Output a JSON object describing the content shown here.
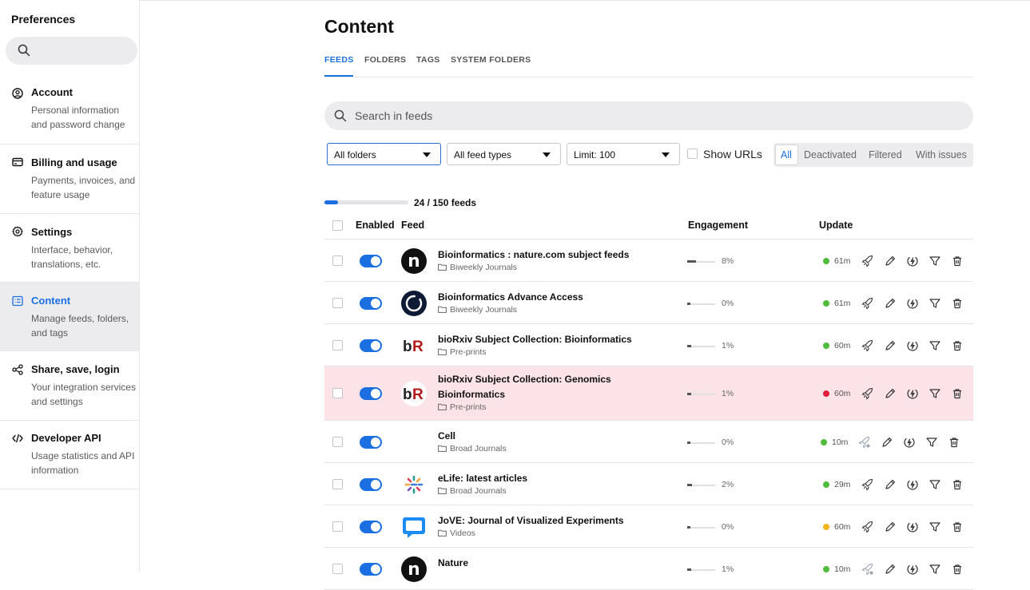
{
  "sidebar": {
    "title": "Preferences",
    "items": [
      {
        "key": "account",
        "label": "Account",
        "desc": "Personal information and password change",
        "icon": "user-circle-icon"
      },
      {
        "key": "billing",
        "label": "Billing and usage",
        "desc": "Payments, invoices, and feature usage",
        "icon": "card-icon"
      },
      {
        "key": "settings",
        "label": "Settings",
        "desc": "Interface, behavior, translations, etc.",
        "icon": "gear-icon"
      },
      {
        "key": "content",
        "label": "Content",
        "desc": "Manage feeds, folders, and tags",
        "icon": "list-icon",
        "active": true
      },
      {
        "key": "share",
        "label": "Share, save, login",
        "desc": "Your integration services and settings",
        "icon": "share-icon"
      },
      {
        "key": "api",
        "label": "Developer API",
        "desc": "Usage statistics and API information",
        "icon": "code-icon"
      }
    ]
  },
  "main": {
    "title": "Content",
    "tabs": [
      "FEEDS",
      "FOLDERS",
      "TAGS",
      "SYSTEM FOLDERS"
    ],
    "search_placeholder": "Search in feeds",
    "filters": {
      "folders": "All folders",
      "types": "All feed types",
      "limit": "Limit: 100",
      "show_urls": "Show URLs",
      "segments": [
        "All",
        "Deactivated",
        "Filtered",
        "With issues"
      ],
      "selected_segment": "All"
    },
    "progress": {
      "text": "24 / 150 feeds",
      "fraction": 0.16
    },
    "columns": {
      "enabled": "Enabled",
      "feed": "Feed",
      "engagement": "Engagement",
      "update": "Update"
    },
    "accent": "#1c6fe0",
    "rows": [
      {
        "name": "Bioinformatics : nature.com subject feeds",
        "folder": "Biweekly Journals",
        "engagement": "8%",
        "eng_fraction": 0.3,
        "update": "61m",
        "status": "ok",
        "icon": "nature-n-logo"
      },
      {
        "name": "Bioinformatics Advance Access",
        "folder": "Biweekly Journals",
        "engagement": "0%",
        "eng_fraction": 0.12,
        "update": "61m",
        "status": "ok",
        "icon": "oup-ring-logo"
      },
      {
        "name": "bioRxiv Subject Collection: Bioinformatics",
        "folder": "Pre-prints",
        "engagement": "1%",
        "eng_fraction": 0.15,
        "update": "60m",
        "status": "ok",
        "icon": "biorxiv-logo"
      },
      {
        "name": "bioRxiv Subject Collection: Genomics Bioinformatics",
        "folder": "Pre-prints",
        "engagement": "1%",
        "eng_fraction": 0.15,
        "update": "60m",
        "status": "error",
        "icon": "biorxiv-logo"
      },
      {
        "name": "Cell",
        "folder": "Broad Journals",
        "engagement": "0%",
        "eng_fraction": 0.12,
        "update": "10m",
        "status": "ok",
        "icon": "none"
      },
      {
        "name": "eLife: latest articles",
        "folder": "Broad Journals",
        "engagement": "2%",
        "eng_fraction": 0.18,
        "update": "29m",
        "status": "ok",
        "icon": "elife-logo"
      },
      {
        "name": "JoVE: Journal of Visualized Experiments",
        "folder": "Videos",
        "engagement": "0%",
        "eng_fraction": 0.12,
        "update": "60m",
        "status": "warn",
        "icon": "jove-bubble-logo"
      },
      {
        "name": "Nature",
        "folder": "",
        "engagement": "1%",
        "eng_fraction": 0.15,
        "update": "10m",
        "status": "ok",
        "icon": "nature-n-logo"
      }
    ],
    "status_colors": {
      "ok": "#4fbd3b",
      "error": "#e21b3c",
      "warn": "#f5b323"
    }
  }
}
